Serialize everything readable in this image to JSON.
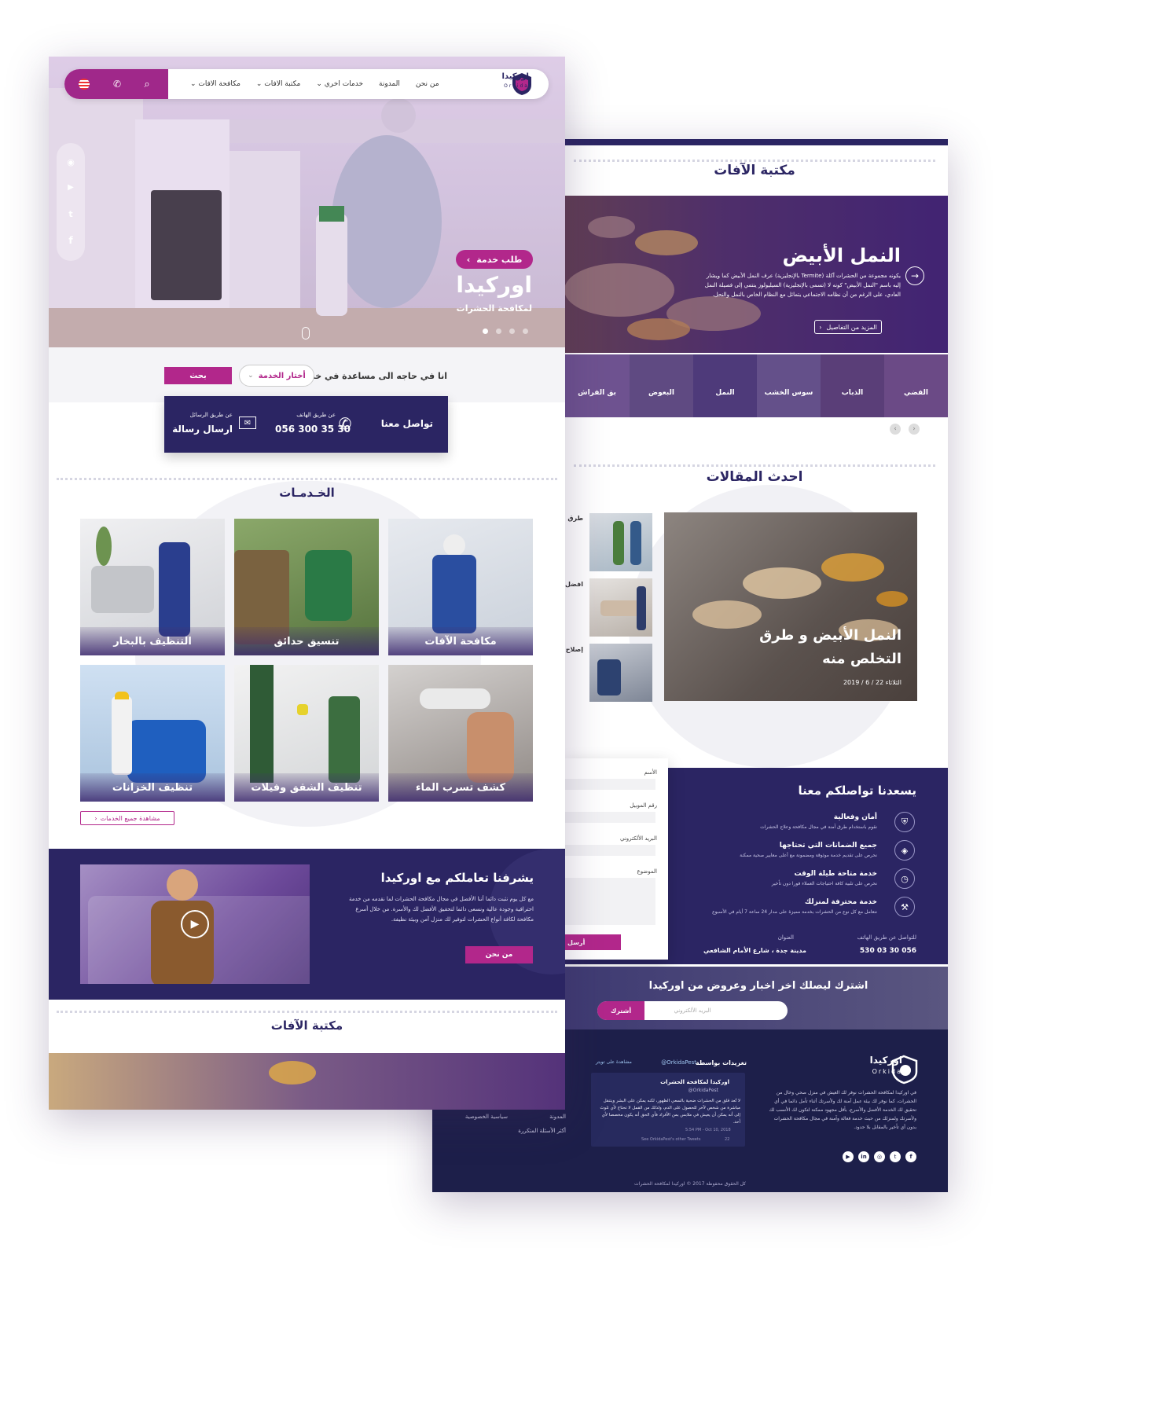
{
  "brand": {
    "name_ar": "اوركيدا",
    "name_en": "Orkida"
  },
  "nav": {
    "items": [
      "مكافحة الافات",
      "مكتبة الافات",
      "خدمات اخري",
      "المدونة",
      "من نحن"
    ]
  },
  "hero": {
    "title": "اوركيدا",
    "subtitle": "لمكافحة الحشرات",
    "cta": "طلب خدمة"
  },
  "search_bar": {
    "prompt": "انا في حاجه الى مساعدة في خدمة",
    "select_value": "أختار الخدمة",
    "button": "بحث"
  },
  "contact_bar": {
    "title": "تواصل معنا",
    "phone_caption": "عن طريق الهاتف",
    "phone": "056 300 35 30",
    "msg_caption": "عن طريق الرسائل",
    "msg_label": "ارسال رسالة"
  },
  "services": {
    "title": "الخـدمـات",
    "items": [
      "مكافحة الآفات",
      "تنسيق حدائق",
      "التنظيف بالبخار",
      "كشف تسرب الماء",
      "تنظيف الشقق وفيلات",
      "تنظيف الخزانات"
    ],
    "all_link": "مشاهدة جميع الخدمات"
  },
  "about": {
    "title": "يشرفنا تعاملكم مع اوركيدا",
    "body": "مع كل يوم نثبت دائما أننا الأفضل في مجال مكافحة الحشرات لما نقدمه من خدمة احترافية وجودة عالية ونسعى دائما لتحقيق الأفضل لك والأسرة. من خلال أسرع مكافحة لكافة أنواع الحشرات لتوفير لك منزل آمن وبيئة نظيفة.",
    "button": "من نحن"
  },
  "library_left": {
    "title": "مكتبة الآفات"
  },
  "library": {
    "title": "مكتبة الآفات",
    "feature_title": "النمل الأبيض",
    "feature_body": "يكونه مجموعة من الحشرات آكلة (Termite بالإنجليزية) عرف النمل الأبيض كما ويشار إليه باسم \"النمل الأبيض\" كونه لا (تسمى بالإنجليزية) السيليولوز ينتمي إلى فصيلة النمل العادي، على الرغم من أن نظامه الاجتماعي يتماثل مع النظام الخاص بالنمل والنحل.",
    "more_button": "المزيد من التفاصيل",
    "pests": [
      "الفضي",
      "الذباب",
      "سوس الخشب",
      "النمل",
      "البعوض",
      "بق الفراش"
    ]
  },
  "articles": {
    "title": "احدث المقالات",
    "feature_title": "النمل الأبيض و طرق التخلص منه",
    "feature_date": "الثلاثاء 22 / 6 / 2019",
    "side_titles": [
      "طرق",
      "افضل",
      "إصلاح"
    ],
    "side_date": "الثلاثاء 22"
  },
  "why_us": {
    "title": "يسعدنا تواصلكم معنا",
    "features": [
      {
        "title": "أمان وفعالية",
        "desc": "نقوم باستخدام طرق آمنة في مجال مكافحة وعلاج الحشرات"
      },
      {
        "title": "جميع الضمانات التي تحتاجها",
        "desc": "نحرص على تقديم خدمة موثوقة ومضمونة مع أعلى معايير صحية ممكنة"
      },
      {
        "title": "خدمة متاحة طيلة الوقت",
        "desc": "نحرص على تلبية كافة احتياجات العملاء فورا دون تأخير"
      },
      {
        "title": "خدمة محترفة لمنزلك",
        "desc": "نتعامل مع كل نوع من الحشرات بخدمة مميزة على مدار 24 ساعة 7 أيام في الأسبوع"
      }
    ],
    "phone_caption": "للتواصل عن طريق الهاتف",
    "phone": "056 30 03 530",
    "address_caption": "العنوان",
    "address": "مدينة جدة ، شارع الأمام الشافعي"
  },
  "form": {
    "fields": [
      "الأسم",
      "رقم الموبيل",
      "البريد الألكتروني",
      "الموضوع"
    ],
    "submit": "أرسل"
  },
  "newsletter": {
    "title": "اشترك ليصلك اخر اخبار وعروض من اوركيدا",
    "placeholder": "البريد الألكتروني",
    "button": "أشترك"
  },
  "footer": {
    "about": "في اوركيدا لمكافحة الحشرات نوفر لك العيش في منزل صحي وخال من الحشرات، كما نوفر لك بيئة عمل آمنة لك ولأسرتك أثناء تأمل دائما في أي تحقيق لك الخدمة الأفضل والأسرع، بأقل مجهود ممكنة لتكون لك الأنسب لك ولأسرتك ولمنزلك من حيث خدمة فعالة وآمنة في مجال مكافحة الحشرات بدون أي تأخير بالمقابل بلا حدود.",
    "tweets_title": "تغريدات بواسطة",
    "tweets_handle": "@OrkidaPest",
    "tweets_view": "مشاهدة على تويتر",
    "tweet_name": "اوركيدا لمكافحة الحشرات",
    "tweet_user": "@OrkidaPest",
    "tweet_text": "لا تُعد قلق من الحشرات ضحية بالسعي الظهور، لكنه يمكن على البشر ويتنقل مباشرة من شخص لآخر للحصول على الدم، ولذلك من القمل لا تحتاج لأي تلوث إلى أنه يمكن أن يعيش في ملابس بمن الأفراد فأي الحق أنه يكون مخصصا لأي أحد.",
    "tweet_time": "5:54 PM - Oct 10, 2018",
    "tweet_more": "See OrkidaPest's other Tweets",
    "tweet_likes": "22",
    "links": [
      "المدونة",
      "سياسية الخصوصية",
      "أكثر الأسئلة المتكررة"
    ],
    "copyright": "كل الحقوق محفوظة 2017 © اوركيدا لمكافحة الحشرات"
  },
  "colors": {
    "navy": "#2b2563",
    "magenta": "#b2278b",
    "purple": "#5c3c8c",
    "footer": "#1d1f4a"
  },
  "icons": [
    "search-icon",
    "phone-icon",
    "flag-icon",
    "whatsapp-icon",
    "youtube-icon",
    "twitter-icon",
    "facebook-icon",
    "mail-icon",
    "play-icon",
    "arrow-right-icon",
    "shield-icon",
    "instagram-icon",
    "linkedin-icon"
  ]
}
